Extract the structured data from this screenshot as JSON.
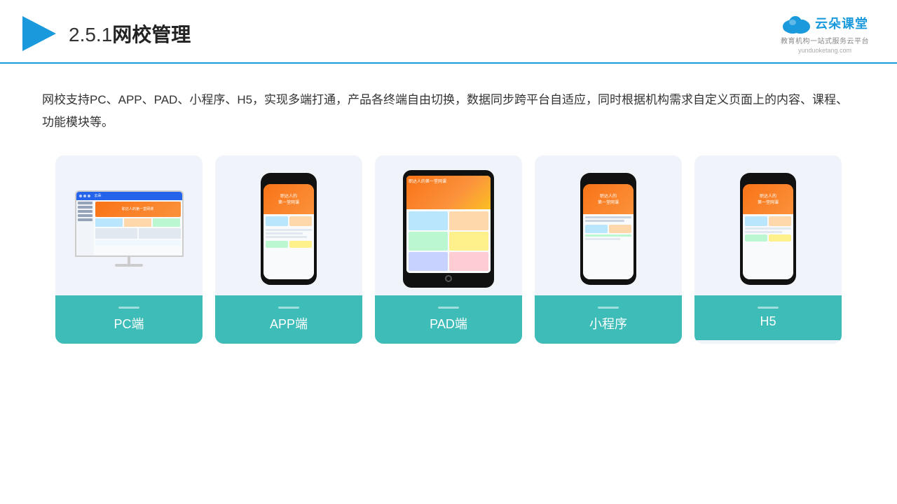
{
  "header": {
    "section_number": "2.5.1",
    "title": "网校管理",
    "logo_text": "云朵课堂",
    "logo_url": "yunduoketang.com",
    "logo_tagline": "教育机构一站式服务云平台"
  },
  "description": {
    "text": "网校支持PC、APP、PAD、小程序、H5，实现多端打通，产品各终端自由切换，数据同步跨平台自适应，同时根据机构需求自定义页面上的内容、课程、功能模块等。"
  },
  "cards": [
    {
      "id": "pc",
      "label": "PC端"
    },
    {
      "id": "app",
      "label": "APP端"
    },
    {
      "id": "pad",
      "label": "PAD端"
    },
    {
      "id": "miniapp",
      "label": "小程序"
    },
    {
      "id": "h5",
      "label": "H5"
    }
  ],
  "colors": {
    "accent_blue": "#1a9adc",
    "teal": "#3dbcb8",
    "header_border": "#1a9adc"
  }
}
